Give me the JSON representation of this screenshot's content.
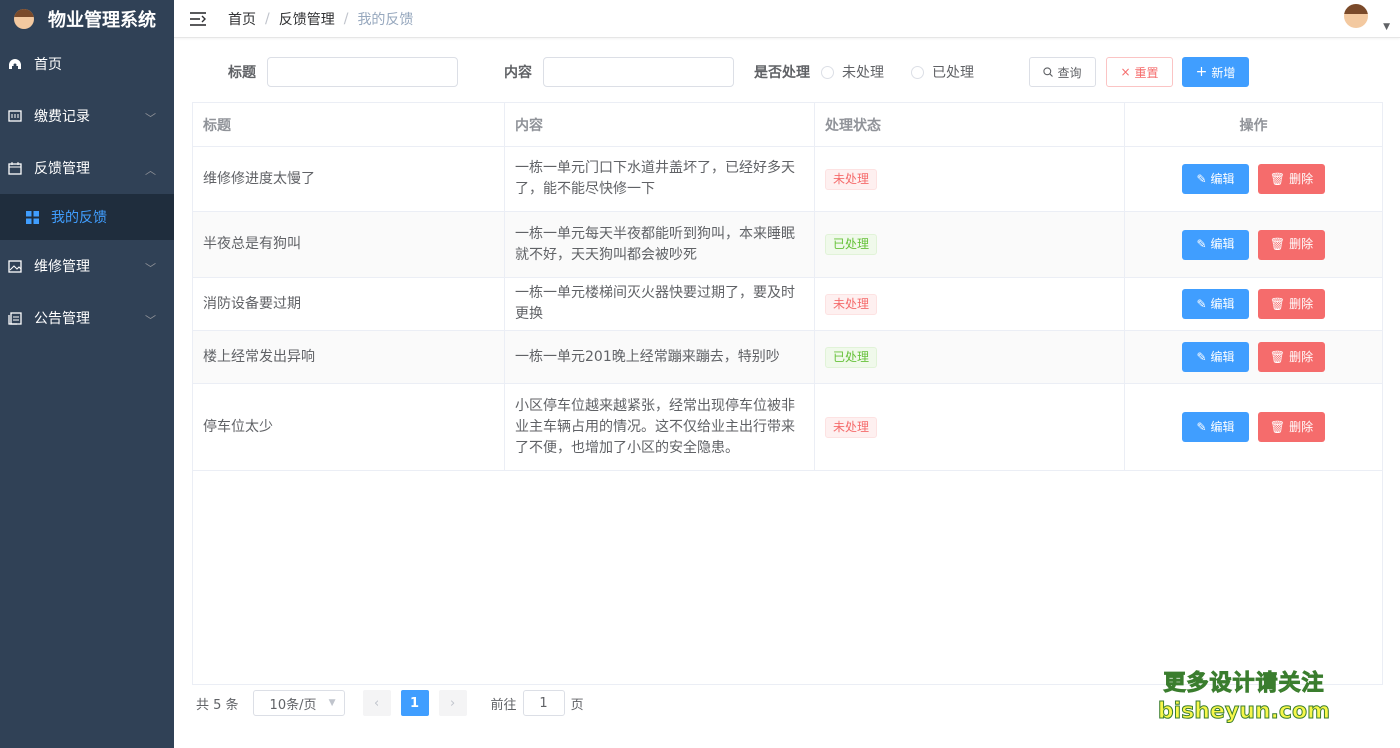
{
  "app": {
    "title": "物业管理系统"
  },
  "sidebar": {
    "items": [
      {
        "label": "首页",
        "icon": "dashboard-icon"
      },
      {
        "label": "缴费记录",
        "icon": "payment-icon"
      },
      {
        "label": "反馈管理",
        "icon": "calendar-icon"
      },
      {
        "label": "我的反馈",
        "icon": "grid-icon"
      },
      {
        "label": "维修管理",
        "icon": "picture-icon"
      },
      {
        "label": "公告管理",
        "icon": "copy-icon"
      }
    ]
  },
  "breadcrumb": [
    "首页",
    "反馈管理",
    "我的反馈"
  ],
  "search": {
    "title_label": "标题",
    "content_label": "内容",
    "handled_label": "是否处理",
    "radio_unhandled": "未处理",
    "radio_handled": "已处理",
    "query_button": "查询",
    "reset_button": "重置",
    "add_button": "新增"
  },
  "table": {
    "headers": [
      "标题",
      "内容",
      "处理状态",
      "操作"
    ],
    "edit_label": "编辑",
    "delete_label": "删除",
    "rows": [
      {
        "title": "维修修进度太慢了",
        "content": "一栋一单元门口下水道井盖坏了，已经好多天了，能不能尽快修一下",
        "status": "未处理"
      },
      {
        "title": "半夜总是有狗叫",
        "content": "一栋一单元每天半夜都能听到狗叫，本来睡眠就不好，天天狗叫都会被吵死",
        "status": "已处理"
      },
      {
        "title": "消防设备要过期",
        "content": "一栋一单元楼梯间灭火器快要过期了，要及时更换",
        "status": "未处理"
      },
      {
        "title": "楼上经常发出异响",
        "content": "一栋一单元201晚上经常蹦来蹦去，特别吵",
        "status": "已处理"
      },
      {
        "title": "停车位太少",
        "content": "小区停车位越来越紧张，经常出现停车位被非业主车辆占用的情况。这不仅给业主出行带来了不便，也增加了小区的安全隐患。",
        "status": "未处理"
      }
    ]
  },
  "pagination": {
    "total": "共 5 条",
    "page_size": "10条/页",
    "current_page": "1",
    "goto_prefix": "前往",
    "goto_value": "1",
    "goto_suffix": "页"
  },
  "watermark": {
    "line1": "更多设计请关注",
    "line2": "bisheyun.com"
  },
  "colors": {
    "sidebar": "#304156",
    "primary": "#409eff",
    "danger": "#f56c6c",
    "success": "#67c23a"
  }
}
